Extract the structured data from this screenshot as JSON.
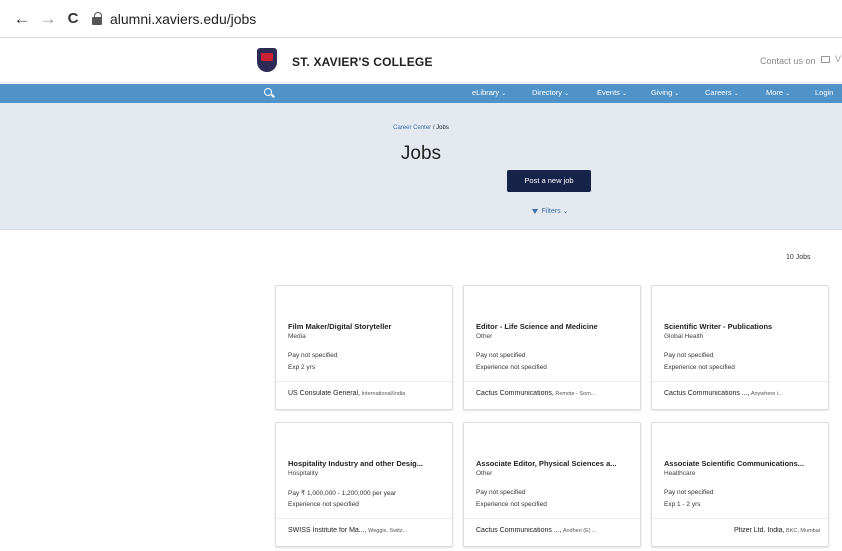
{
  "browser": {
    "url": "alumni.xaviers.edu/jobs",
    "back_icon": "←",
    "forward_icon": "→",
    "reload_icon": "C"
  },
  "header": {
    "college_name": "ST. XAVIER'S COLLEGE",
    "contact": "Contact us on"
  },
  "navbar": {
    "items": [
      {
        "label": "eLibrary",
        "caret": "⌄"
      },
      {
        "label": "Directory",
        "caret": "⌄"
      },
      {
        "label": "Events",
        "caret": "⌄"
      },
      {
        "label": "Giving",
        "caret": "⌄"
      },
      {
        "label": "Careers",
        "caret": "⌄"
      },
      {
        "label": "More",
        "caret": "⌄"
      },
      {
        "label": "Login",
        "caret": ""
      }
    ]
  },
  "hero": {
    "breadcrumb_link": "Career Center",
    "breadcrumb_sep": " / ",
    "breadcrumb_current": "Jobs",
    "title": "Jobs",
    "post_button": "Post a new job",
    "filters_label": "Filters",
    "filters_caret": "⌄"
  },
  "jobs_count": "10 Jobs",
  "jobs": [
    {
      "title": "Film Maker/Digital Storyteller",
      "category": "Media",
      "pay": "Pay not specified",
      "experience": "Exp 2 yrs",
      "company": "US Consulate General,",
      "location": " International/India"
    },
    {
      "title": "Editor - Life Science and Medicine",
      "category": "Other",
      "pay": "Pay not specified",
      "experience": "Experience not specified",
      "company": "Cactus Communications,",
      "location": " Remote - Som..."
    },
    {
      "title": "Scientific Writer - Publications",
      "category": "Global Health",
      "pay": "Pay not specified",
      "experience": "Experience not specified",
      "company": "Cactus Communications ...,",
      "location": " Anywhere i..."
    },
    {
      "title": "Hospitality Industry and other Desig...",
      "category": "Hospitality",
      "pay": "Pay ₹ 1,000,000 - 1,200,000 per year",
      "experience": "Experience not specified",
      "company": "SWISS Institute for Ma...,",
      "location": " Weggis, Switz..."
    },
    {
      "title": "Associate Editor, Physical Sciences a...",
      "category": "Other",
      "pay": "Pay not specified",
      "experience": "Experience not specified",
      "company": "Cactus Communications ...,",
      "location": " Andheri (E) ..."
    },
    {
      "title": "Associate Scientific Communications...",
      "category": "Healthcare",
      "pay": "Pay not specified",
      "experience": "Exp 1 - 2 yrs",
      "company": "Pfizer Ltd. India,",
      "location": " BKC, Mumbai"
    }
  ]
}
